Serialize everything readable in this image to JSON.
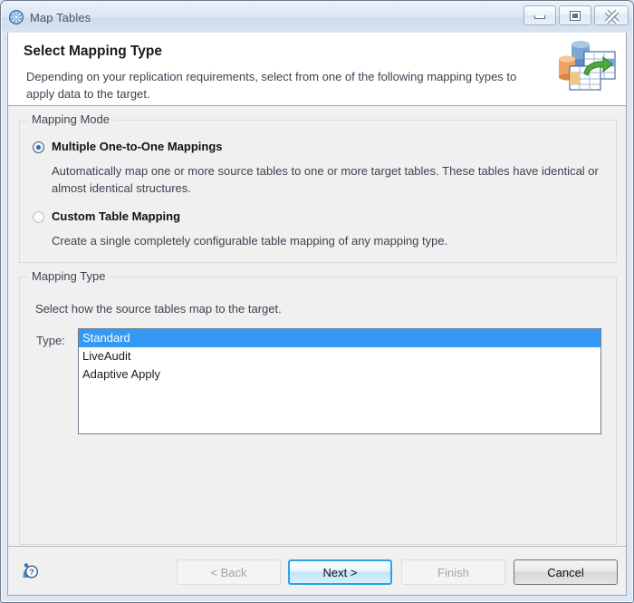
{
  "window": {
    "title": "Map Tables",
    "icon": "globe-icon",
    "controls": {
      "minimize": "Minimize",
      "maximize": "Maximize",
      "close": "Close"
    }
  },
  "banner": {
    "title": "Select Mapping Type",
    "description": "Depending on your replication requirements, select from one of the following mapping types to apply data to the target.",
    "icon": "map-tables-banner-icon"
  },
  "mapping_mode": {
    "group_label": "Mapping Mode",
    "options": [
      {
        "label": "Multiple One-to-One Mappings",
        "description": "Automatically map one or more source tables to one or more target tables. These tables have identical or almost identical structures.",
        "selected": true
      },
      {
        "label": "Custom Table Mapping",
        "description": "Create a single completely configurable table mapping of any mapping type.",
        "selected": false
      }
    ]
  },
  "mapping_type": {
    "group_label": "Mapping Type",
    "instruction": "Select how the source tables map to the target.",
    "field_label": "Type:",
    "options": [
      "Standard",
      "LiveAudit",
      "Adaptive Apply"
    ],
    "selected": "Standard"
  },
  "buttons": {
    "help_icon": "help-icon",
    "back": "< Back",
    "next": "Next >",
    "finish": "Finish",
    "cancel": "Cancel"
  },
  "colors": {
    "selection_blue": "#3399f3",
    "default_button_border": "#2aa3e8",
    "content_background": "#f0f0f0"
  }
}
